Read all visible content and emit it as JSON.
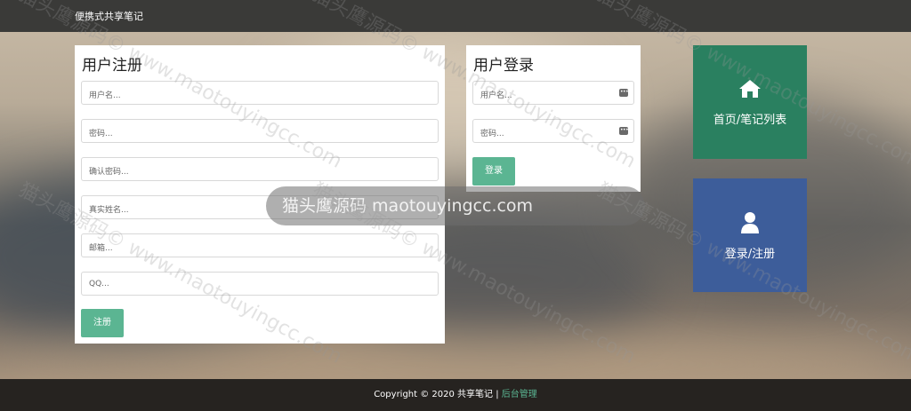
{
  "app": {
    "brand": "便携式共享笔记"
  },
  "register": {
    "title": "用户注册",
    "fields": {
      "username": "用户名...",
      "password": "密码...",
      "confirm_password": "确认密码...",
      "real_name": "真实姓名...",
      "email": "邮箱...",
      "qq": "QQ..."
    },
    "submit_label": "注册"
  },
  "login": {
    "title": "用户登录",
    "fields": {
      "username": "用户名...",
      "password": "密码..."
    },
    "submit_label": "登录"
  },
  "tiles": {
    "home": {
      "label": "首页/笔记列表",
      "icon": "home-icon",
      "color": "#2a8060"
    },
    "account": {
      "label": "登录/注册",
      "icon": "user-icon",
      "color": "#3d5d9a"
    }
  },
  "watermark": {
    "text": "猫头鹰源码 maotouyingcc.com",
    "repeat": "猫头鹰源码© www.maotouyingcc.com"
  },
  "footer": {
    "copyright": "Copyright © 2020 共享笔记 | ",
    "admin_link": "后台管理"
  },
  "colors": {
    "accent": "#5bb592",
    "topbar": "#3a3a38",
    "footer": "#262320"
  }
}
